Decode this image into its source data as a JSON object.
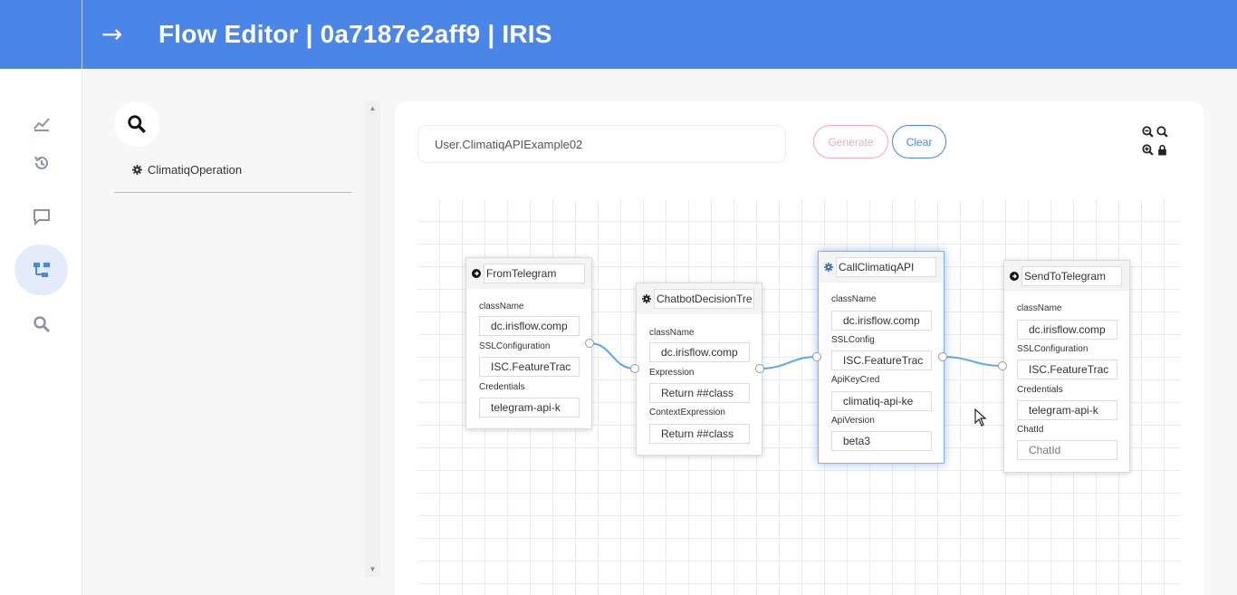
{
  "header": {
    "title": "Flow Editor | 0a7187e2aff9 | IRIS",
    "back_icon": "arrow-right-icon",
    "color": "#4a86e8"
  },
  "sidenav": {
    "items": [
      {
        "icon": "chart-icon",
        "active": false
      },
      {
        "icon": "history-icon",
        "active": false
      },
      {
        "icon": "chat-icon",
        "active": false
      },
      {
        "icon": "flow-icon",
        "active": true
      },
      {
        "icon": "search-icon",
        "active": false
      }
    ]
  },
  "leftpanel": {
    "search_icon": "search-icon",
    "operations": [
      {
        "label": "ClimatiqOperation",
        "icon": "gear-icon"
      }
    ]
  },
  "toolbar": {
    "flow_name": "User.ClimatiqAPIExample02",
    "generate_label": "Generate",
    "clear_label": "Clear",
    "zoom_icons": [
      "zoom-out-icon",
      "zoom-reset-icon",
      "zoom-in-icon",
      "lock-icon"
    ]
  },
  "nodes": {
    "from_telegram": {
      "name": "FromTelegram",
      "icon": "arrow-in-icon",
      "fields": [
        {
          "label": "className",
          "value": "dc.irisflow.comp"
        },
        {
          "label": "SSLConfiguration",
          "value": "ISC.FeatureTrac"
        },
        {
          "label": "Credentials",
          "value": "telegram-api-k"
        }
      ]
    },
    "chatbot_decision": {
      "name": "ChatbotDecisionTre",
      "icon": "gear-icon",
      "fields": [
        {
          "label": "className",
          "value": "dc.irisflow.comp"
        },
        {
          "label": "Expression",
          "value": "Return ##class"
        },
        {
          "label": "ContextExpression",
          "value": "Return ##class"
        }
      ]
    },
    "call_climatiq": {
      "name": "CallClimatiqAPI",
      "icon": "gear-icon",
      "fields": [
        {
          "label": "className",
          "value": "dc.irisflow.comp"
        },
        {
          "label": "SSLConfig",
          "value": "ISC.FeatureTrac"
        },
        {
          "label": "ApiKeyCred",
          "value": "climatiq-api-ke"
        },
        {
          "label": "ApiVersion",
          "value": "beta3"
        }
      ]
    },
    "send_to_telegram": {
      "name": "SendToTelegram",
      "icon": "arrow-in-icon",
      "fields": [
        {
          "label": "className",
          "value": "dc.irisflow.comp"
        },
        {
          "label": "SSLConfiguration",
          "value": "ISC.FeatureTrac"
        },
        {
          "label": "Credentials",
          "value": "telegram-api-k"
        }
      ],
      "chat_id_label": "ChatId",
      "chat_id_placeholder": "ChatId"
    }
  },
  "colors": {
    "wire": "#5aa9f0",
    "generate": "#f3a6c9",
    "clear": "#4a86e8"
  }
}
